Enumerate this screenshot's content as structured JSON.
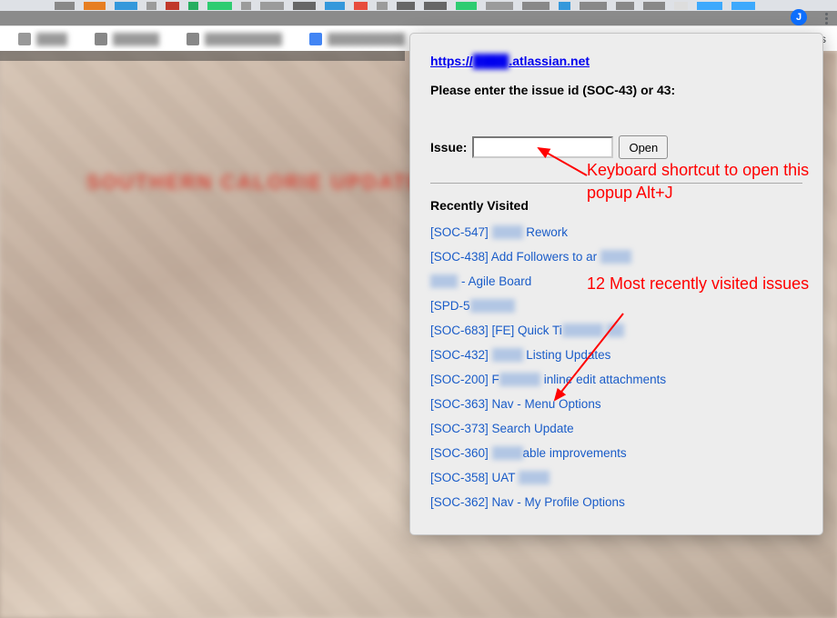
{
  "browser": {
    "bookmarks_label": "arks"
  },
  "page_bg_title": "SOUTHERN CALORIE UPDATE",
  "page_bg_title_color": "#d84a3c",
  "popup": {
    "url_display": "https://████.atlassian.net",
    "prompt": "Please enter the issue id (SOC-43) or 43:",
    "issue_label": "Issue:",
    "issue_value": "",
    "open_label": "Open",
    "recent_header": "Recently Visited",
    "recent_items": [
      "[SOC-547] ████████ Rework",
      "[SOC-438] Add Followers to ar ████████",
      "███████ - Agile Board",
      "[SPD-5████████████",
      "[SOC-683] [FE] Quick Ti███████████ ████",
      "[SOC-432] ████████ Listing Updates",
      "[SOC-200] F███████████ inline edit attachments",
      "[SOC-363] Nav - Menu Options",
      "[SOC-373] Search Update",
      "[SOC-360] ████████able improvements",
      "[SOC-358] UAT ████████",
      "[SOC-362] Nav - My Profile Options"
    ]
  },
  "annotations": {
    "shortcut": "Keyboard shortcut to open this popup Alt+J",
    "recent_count": "12 Most recently visited issues"
  },
  "tab_colors": [
    "#888",
    "#e67e22",
    "#3498db",
    "#9b9b9b",
    "#c0392b",
    "#27ae60",
    "#2ecc71",
    "#9b9b9b",
    "#9b9b9b",
    "#666",
    "#3498db",
    "#e74c3c",
    "#9b9b9b",
    "#666",
    "#666",
    "#2ecc71",
    "#9b9b9b",
    "#888",
    "#3498db",
    "#888",
    "#888",
    "#888",
    "#ddd",
    "#3da9fc",
    "#3da9fc"
  ]
}
